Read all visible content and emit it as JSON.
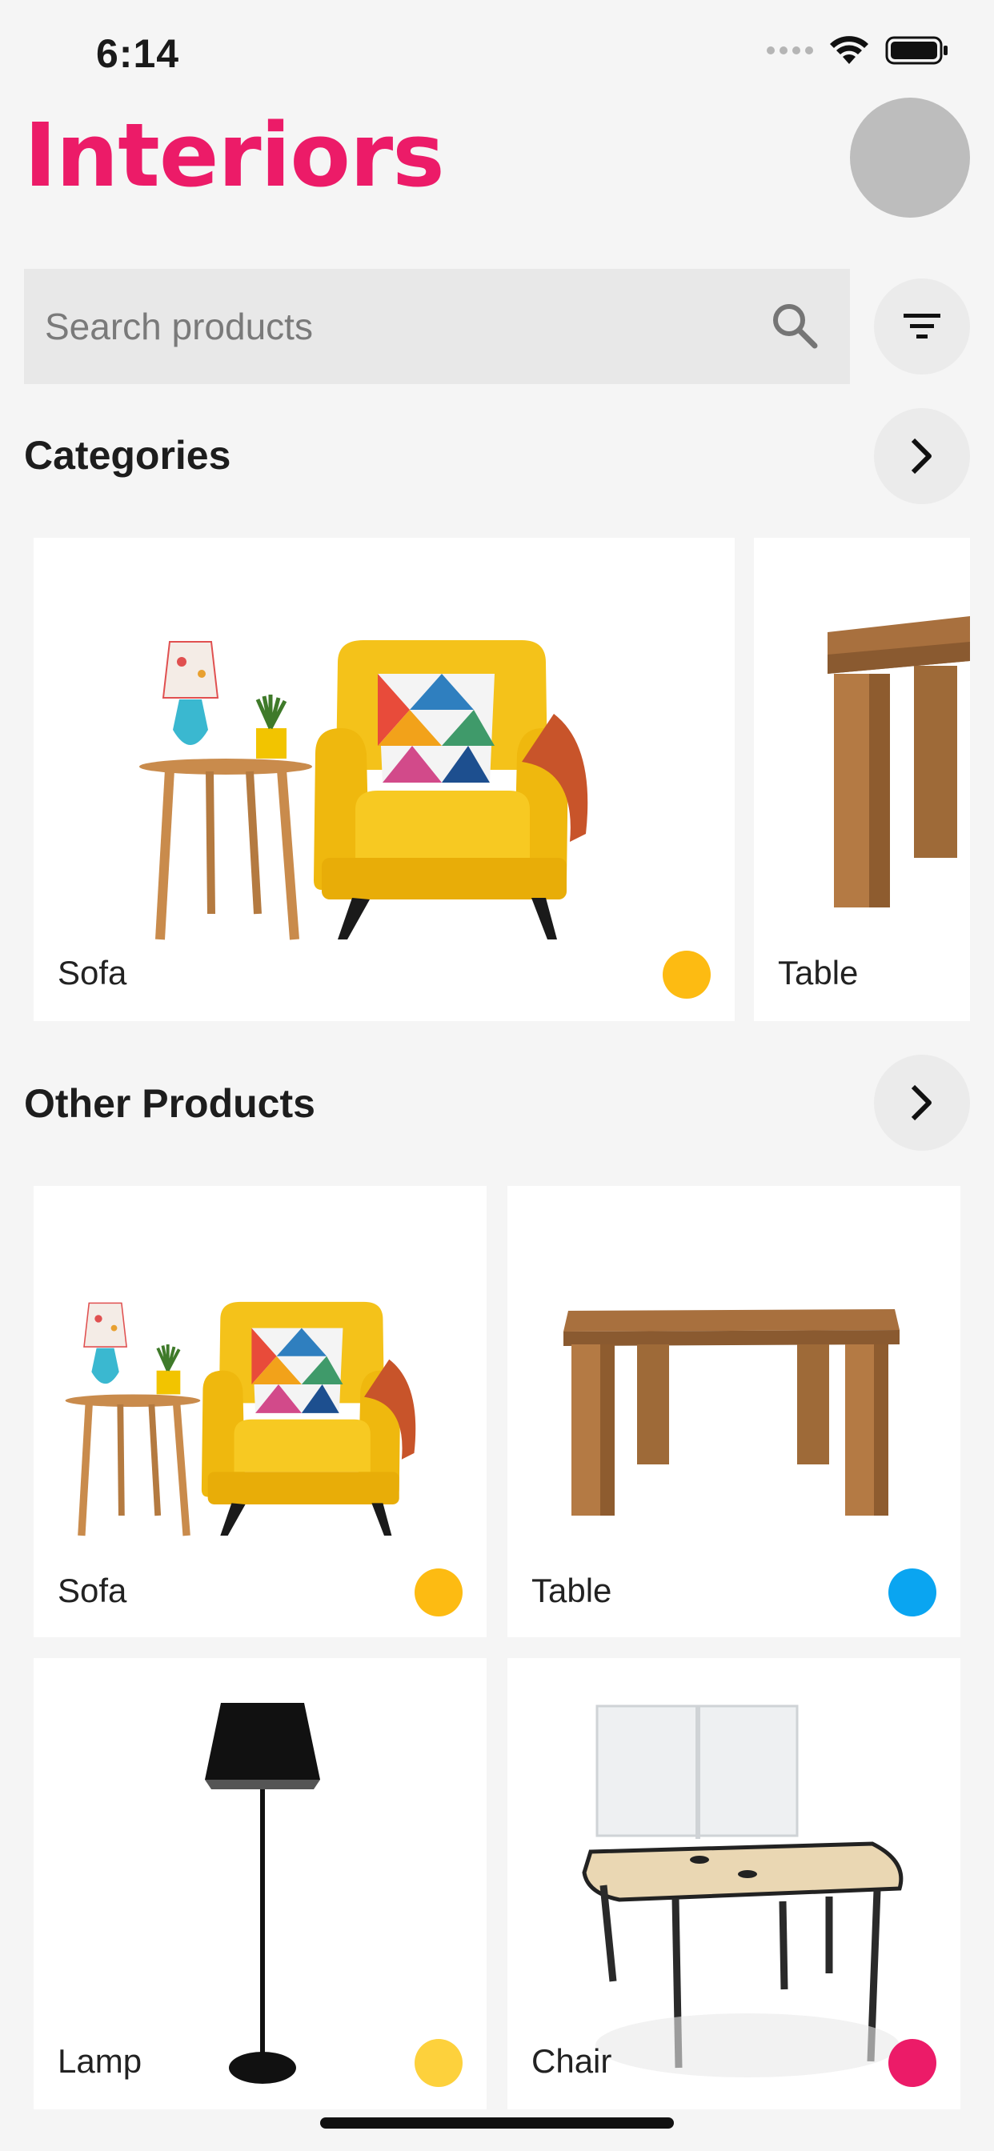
{
  "status": {
    "time": "6:14"
  },
  "header": {
    "title": "Interiors"
  },
  "search": {
    "placeholder": "Search products",
    "value": ""
  },
  "categories": {
    "title": "Categories",
    "items": [
      {
        "label": "Sofa",
        "dot_color": "#fdbb12"
      },
      {
        "label": "Table"
      }
    ]
  },
  "other_products": {
    "title": "Other Products",
    "items": [
      {
        "label": "Sofa",
        "dot_color": "#fdbb12"
      },
      {
        "label": "Table",
        "dot_color": "#0aa5f1"
      },
      {
        "label": "Lamp",
        "dot_color": "#fdd13c"
      },
      {
        "label": "Chair",
        "dot_color": "#ec1b68"
      }
    ]
  },
  "colors": {
    "brand": "#ec1b68",
    "background": "#f5f5f5"
  },
  "icons": [
    "search-icon",
    "filter-icon",
    "chevron-right-icon",
    "wifi-icon",
    "battery-icon"
  ]
}
